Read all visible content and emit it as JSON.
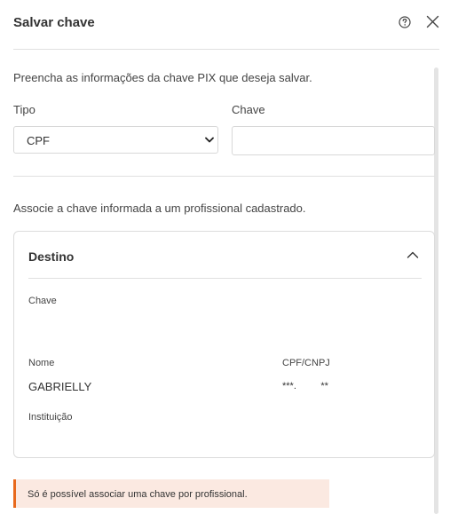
{
  "dialog": {
    "title": "Salvar chave",
    "help_icon": "help-circle-icon",
    "close_icon": "close-icon"
  },
  "form": {
    "intro": "Preencha as informações da chave PIX que deseja salvar.",
    "tipo_label": "Tipo",
    "tipo_value": "CPF",
    "chave_label": "Chave",
    "chave_value": ""
  },
  "associate_text": "Associe a chave informada a um profissional cadastrado.",
  "destino": {
    "title": "Destino",
    "chave_label": "Chave",
    "chave_value": "",
    "nome_label": "Nome",
    "nome_value": "GABRIELLY",
    "cpf_label": "CPF/CNPJ",
    "cpf_value": "***.         **",
    "instituicao_label": "Instituição",
    "instituicao_value": ""
  },
  "alert": {
    "text": "Só é possível associar uma chave por profissional.",
    "color": "#e8691c"
  },
  "colors": {
    "alert_bg": "#fbe9e1",
    "border": "#dcdcdc"
  }
}
